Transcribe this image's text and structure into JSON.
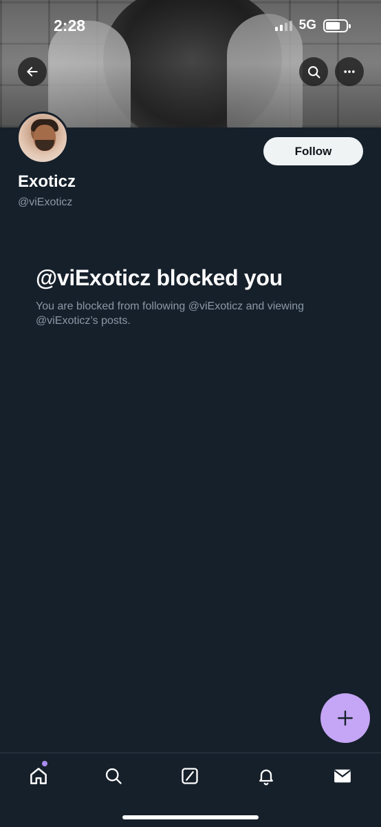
{
  "status_bar": {
    "time": "2:28",
    "network": "5G"
  },
  "header": {
    "back_icon": "arrow-left-icon",
    "search_icon": "search-icon",
    "more_icon": "more-horizontal-icon"
  },
  "profile": {
    "display_name": "Exoticz",
    "handle": "@viExoticz",
    "follow_label": "Follow"
  },
  "blocked": {
    "title": "@viExoticz blocked you",
    "description": "You are blocked from following @viExoticz and viewing @viExoticz’s posts."
  },
  "fab": {
    "icon": "plus-icon"
  },
  "bottom_nav": {
    "items": [
      {
        "icon": "home-icon",
        "has_dot": true
      },
      {
        "icon": "search-icon"
      },
      {
        "icon": "grok-icon"
      },
      {
        "icon": "bell-icon"
      },
      {
        "icon": "mail-icon"
      }
    ]
  },
  "colors": {
    "background": "#16202b",
    "follow_button": "#eff3f4",
    "secondary_text": "#8b98a5",
    "fab": "#c5a5f5",
    "notification_dot": "#a98cf0"
  }
}
